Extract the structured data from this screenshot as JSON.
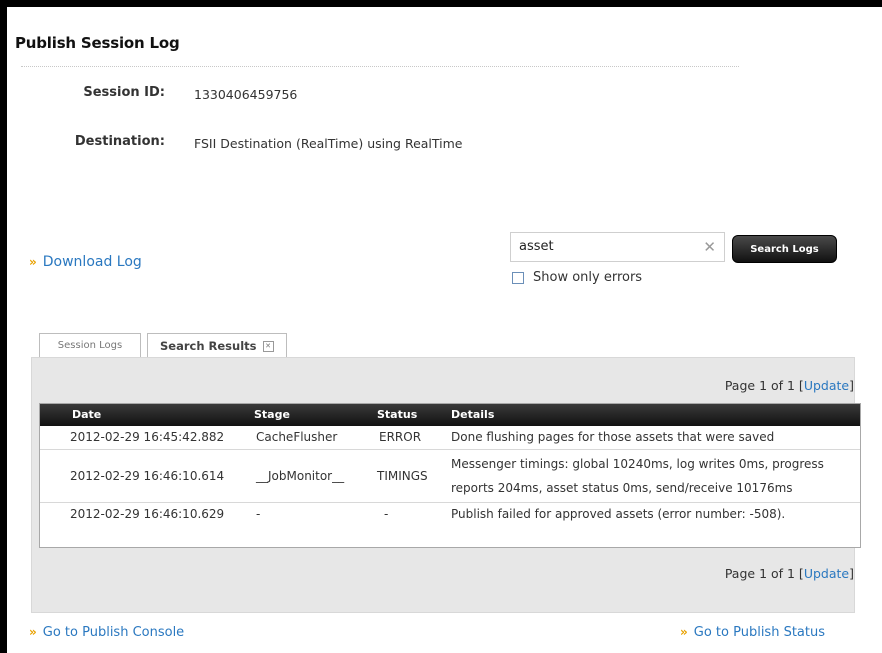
{
  "page": {
    "title": "Publish Session Log"
  },
  "session": {
    "id_label": "Session ID:",
    "id_value": "1330406459756",
    "dest_label": "Destination:",
    "dest_value": "FSII Destination (RealTime) using RealTime"
  },
  "actions": {
    "download_log": "Download Log"
  },
  "search": {
    "value": "asset",
    "button_label": "Search Logs",
    "show_only_errors_label": "Show only errors",
    "show_only_errors_checked": false
  },
  "tabs": [
    {
      "label": "Session Logs",
      "active": false
    },
    {
      "label": "Search Results",
      "active": true
    }
  ],
  "pager": {
    "text": "Page 1 of 1 [",
    "update": "Update",
    "close": "]"
  },
  "table": {
    "columns": [
      "Date",
      "Stage",
      "Status",
      "Details"
    ],
    "rows": [
      {
        "date": "2012-02-29 16:45:42.882",
        "stage": "CacheFlusher",
        "status": "ERROR",
        "details": [
          "Done flushing pages for those assets that were saved"
        ]
      },
      {
        "date": "2012-02-29 16:46:10.614",
        "stage": "__JobMonitor__",
        "status": "TIMINGS",
        "details": [
          "Messenger timings: global 10240ms, log writes 0ms, progress",
          "reports 204ms, asset status 0ms, send/receive 10176ms"
        ]
      },
      {
        "date": "2012-02-29 16:46:10.629",
        "stage": "-",
        "status": "-",
        "details": [
          "Publish failed for approved assets (error number: -508)."
        ]
      }
    ]
  },
  "footer": {
    "publish_console": "Go to Publish Console",
    "publish_status": "Go to Publish Status"
  },
  "colors": {
    "link": "#2a78c0",
    "raquo": "#e8a100",
    "header_dark": "#111111",
    "panel_bg": "#e7e7e7"
  }
}
